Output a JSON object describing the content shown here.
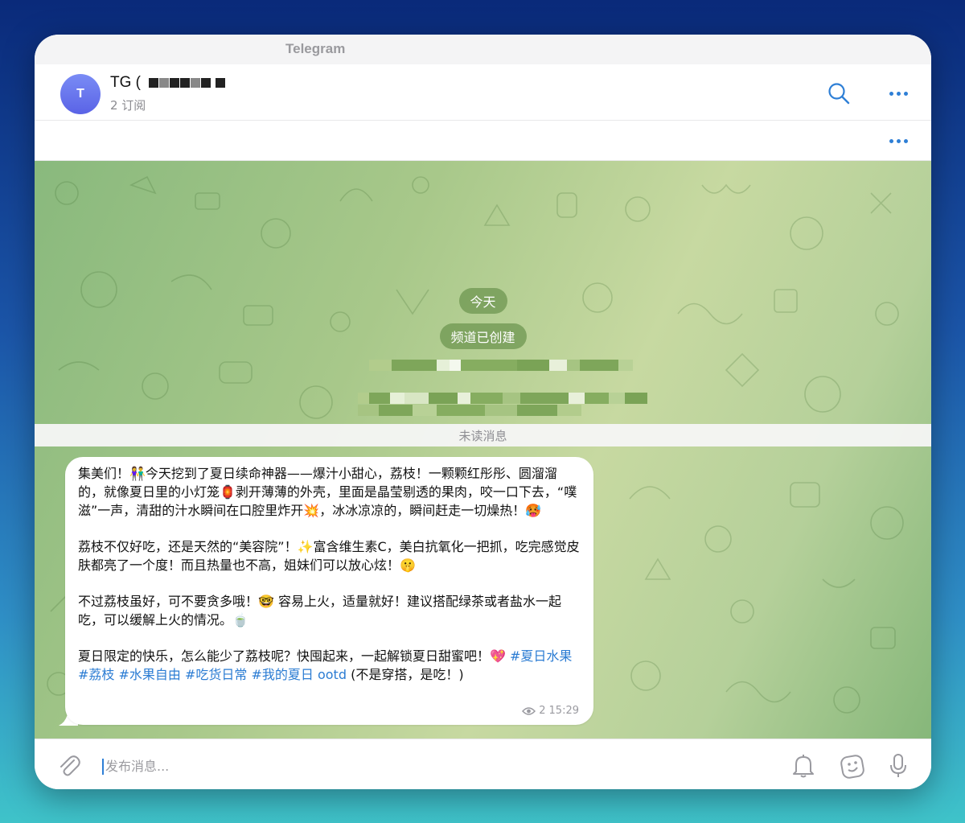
{
  "window": {
    "title": "Telegram"
  },
  "header": {
    "avatar_letter": "T",
    "channel_name": "TG (",
    "subscribers": "2 订阅"
  },
  "chat": {
    "date_pill": "今天",
    "service_message": "频道已创建",
    "unread_label": "未读消息",
    "message": {
      "p1": "集美们！👫今天挖到了夏日续命神器——爆汁小甜心，荔枝！一颗颗红彤彤、圆溜溜的，就像夏日里的小灯笼🏮剥开薄薄的外壳，里面是晶莹剔透的果肉，咬一口下去，“噗滋”一声，清甜的汁水瞬间在口腔里炸开💥，冰冰凉凉的，瞬间赶走一切燥热！🥵",
      "p2": "荔枝不仅好吃，还是天然的“美容院”！✨富含维生素C，美白抗氧化一把抓，吃完感觉皮肤都亮了一个度！而且热量也不高，姐妹们可以放心炫！🤫",
      "p3": "不过荔枝虽好，可不要贪多哦！🤓 容易上火，适量就好！建议搭配绿茶或者盐水一起吃，可以缓解上火的情况。🍵",
      "p4_text": "夏日限定的快乐，怎么能少了荔枝呢？快囤起来，一起解锁夏日甜蜜吧！💖 ",
      "p4_tags": "#夏日水果 #荔枝 #水果自由 #吃货日常 #我的夏日 ootd",
      "p4_tail": " (不是穿搭，是吃！)",
      "views": "2",
      "time": "15:29"
    }
  },
  "composer": {
    "placeholder": "发布消息..."
  },
  "icons": {
    "search": "search-icon",
    "more": "more-icon",
    "attach": "paperclip-icon",
    "bell": "bell-icon",
    "sticker": "sticker-icon",
    "mic": "microphone-icon",
    "eye": "eye-icon"
  },
  "colors": {
    "accent": "#2e7fd6",
    "service_bg": "#6e9650",
    "avatar": "#6a74ee"
  }
}
